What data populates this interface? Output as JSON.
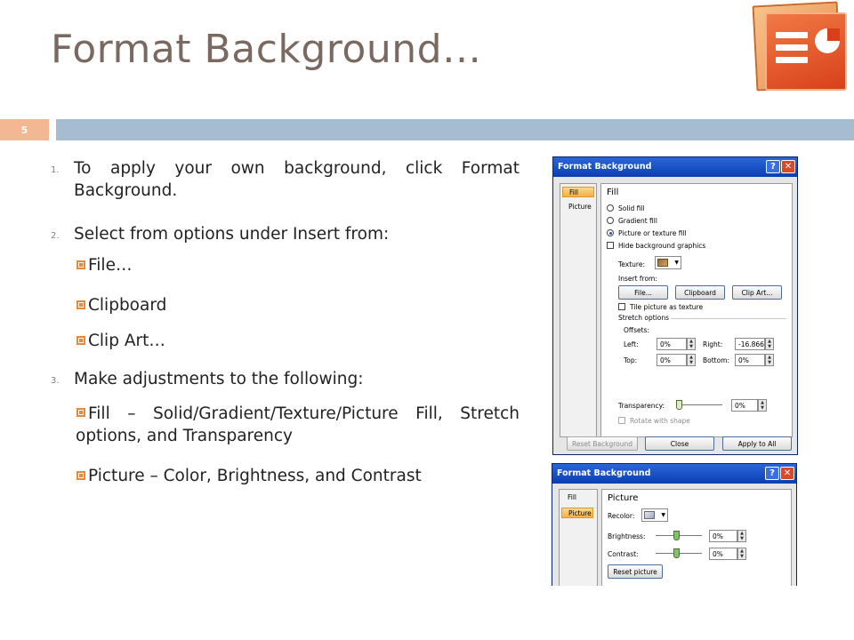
{
  "slide": {
    "title": "Format Background…",
    "number": "5"
  },
  "steps": [
    {
      "num": "1.",
      "text": "To apply your own background, click Format Background."
    },
    {
      "num": "2.",
      "text": "Select from options under Insert from:"
    },
    {
      "num": "3.",
      "text": "Make adjustments to the following:"
    }
  ],
  "sub_step2": [
    "File…",
    "Clipboard",
    "Clip Art…"
  ],
  "sub_step3": [
    "Fill – Solid/Gradient/Texture/Picture Fill, Stretch options, and Transparency",
    "Picture – Color, Brightness, and Contrast"
  ],
  "dialog_fill": {
    "title": "Format Background",
    "help": "?",
    "close": "✕",
    "tabs": [
      "Fill",
      "Picture"
    ],
    "section": "Fill",
    "options": [
      "Solid fill",
      "Gradient fill",
      "Picture or texture fill"
    ],
    "hide_graphics": "Hide background graphics",
    "texture_label": "Texture:",
    "insert_from": "Insert from:",
    "buttons": [
      "File...",
      "Clipboard",
      "Clip Art..."
    ],
    "tile": "Tile picture as texture",
    "stretch": "Stretch options",
    "offsets": "Offsets:",
    "left_label": "Left:",
    "left_value": "0%",
    "right_label": "Right:",
    "right_value": "-16.866",
    "top_label": "Top:",
    "top_value": "0%",
    "bottom_label": "Bottom:",
    "bottom_value": "0%",
    "transparency_label": "Transparency:",
    "transparency_value": "0%",
    "transparency_level": 0,
    "rotate": "Rotate with shape",
    "footer": [
      "Reset Background",
      "Close",
      "Apply to All"
    ]
  },
  "dialog_picture": {
    "title": "Format Background",
    "help": "?",
    "close": "✕",
    "tabs": [
      "Fill",
      "Picture"
    ],
    "section": "Picture",
    "recolor_label": "Recolor:",
    "brightness_label": "Brightness:",
    "brightness_value": "0%",
    "contrast_label": "Contrast:",
    "contrast_value": "0%",
    "reset": "Reset picture"
  },
  "colors": {
    "title": "#7a6960",
    "band": "#a6bcd0",
    "badge": "#f3b793",
    "bullet": "#e7883a"
  }
}
